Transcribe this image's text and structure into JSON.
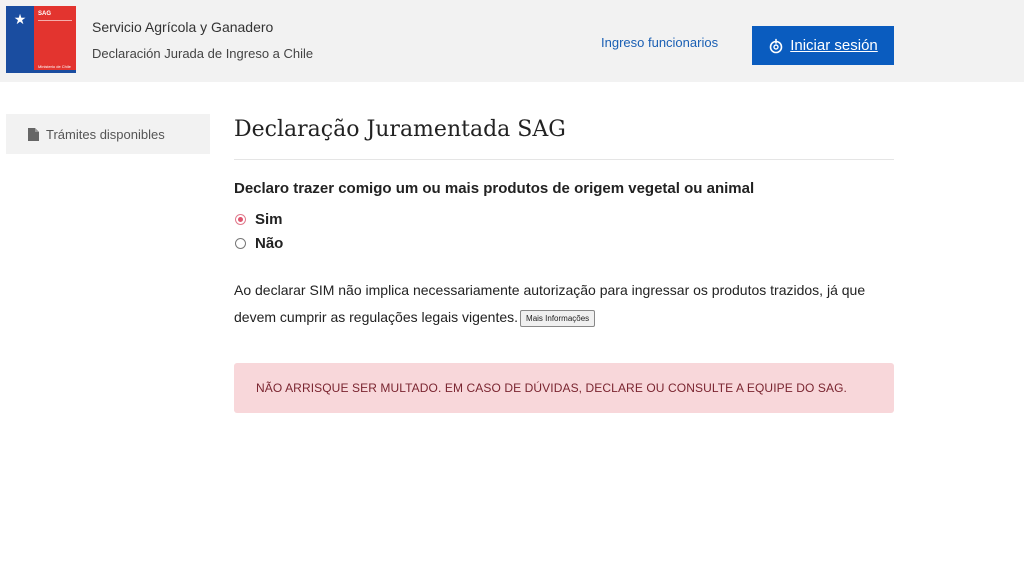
{
  "header": {
    "logo": {
      "brand": "SAG",
      "footer": "Ministerio de Chile"
    },
    "org_name": "Servicio Agrícola y Ganadero",
    "org_subtitle": "Declaración Jurada de Ingreso a Chile",
    "staff_link": "Ingreso funcionarios",
    "login_label": "Iniciar sesión"
  },
  "sidebar": {
    "items": [
      {
        "label": "Trámites disponibles",
        "icon": "document-icon"
      }
    ]
  },
  "main": {
    "title": "Declaração Juramentada SAG",
    "question": "Declaro trazer comigo um ou mais produtos de origem vegetal ou animal",
    "options": [
      {
        "label": "Sim",
        "selected": true
      },
      {
        "label": "Não",
        "selected": false
      }
    ],
    "note": "Ao declarar SIM não implica necessariamente autorização para ingressar os produtos trazidos, já que devem cumprir as regulações legais vigentes.",
    "more_info_label": "Mais Informações",
    "alert": "NÃO ARRISQUE SER MULTADO. EM CASO DE DÚVIDAS, DECLARE OU CONSULTE A EQUIPE DO SAG."
  },
  "colors": {
    "primary": "#0a5cbf",
    "link": "#1a5fb4",
    "alert_bg": "#f8d7da",
    "alert_text": "#7a2530",
    "logo_blue": "#1a4da0",
    "logo_red": "#e3342f"
  }
}
